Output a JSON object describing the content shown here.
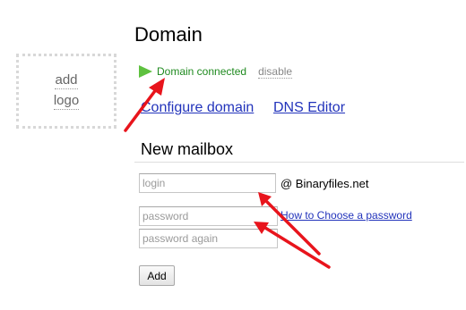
{
  "logo_placeholder": {
    "line1": "add",
    "line2": "logo"
  },
  "page": {
    "title": "Domain"
  },
  "status": {
    "icon": "play-icon",
    "icon_color": "#5ec13f",
    "text": "Domain connected",
    "text_color": "#1f8a1f",
    "disable_label": "disable"
  },
  "links": {
    "configure_domain": "Configure domain",
    "dns_editor": "DNS Editor"
  },
  "mailbox": {
    "heading": "New mailbox",
    "login_placeholder": "login",
    "domain_suffix": "@ Binaryfiles.net",
    "password_placeholder": "password",
    "password_again_placeholder": "password again",
    "choose_password_link": "How to Choose a password",
    "add_button": "Add"
  },
  "annotations": {
    "arrow_color": "#e8141c",
    "arrow_count": 3
  }
}
